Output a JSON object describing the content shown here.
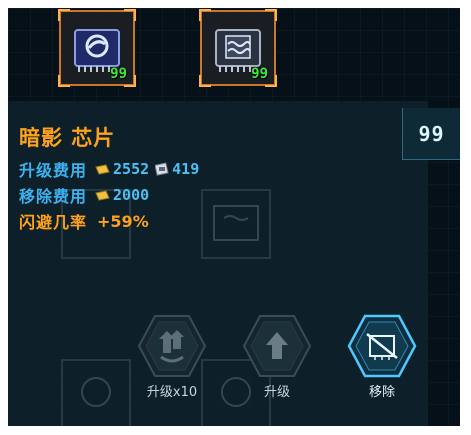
{
  "slots": [
    {
      "name": "shadow-chip",
      "qty": "99"
    },
    {
      "name": "wave-chip",
      "qty": "99"
    }
  ],
  "chip": {
    "title": "暗影 芯片",
    "count": "99",
    "upgrade_cost_label": "升级费用",
    "upgrade_cost_gold": "2552",
    "upgrade_cost_material": "419",
    "remove_cost_label": "移除费用",
    "remove_cost_gold": "2000",
    "stat_label": "闪避几率",
    "stat_value": "+59%"
  },
  "actions": {
    "upgrade_x10": "升级x10",
    "upgrade": "升级",
    "remove": "移除"
  },
  "colors": {
    "title": "#ffa21a",
    "label_blue": "#3bb2f0",
    "qty_green": "#3ee63e",
    "slot_border": "#c9772a"
  },
  "icons": [
    "shadow-chip-icon",
    "wave-chip-icon",
    "gold-icon",
    "material-icon",
    "upgrade-x10-icon",
    "upgrade-icon",
    "remove-icon"
  ]
}
